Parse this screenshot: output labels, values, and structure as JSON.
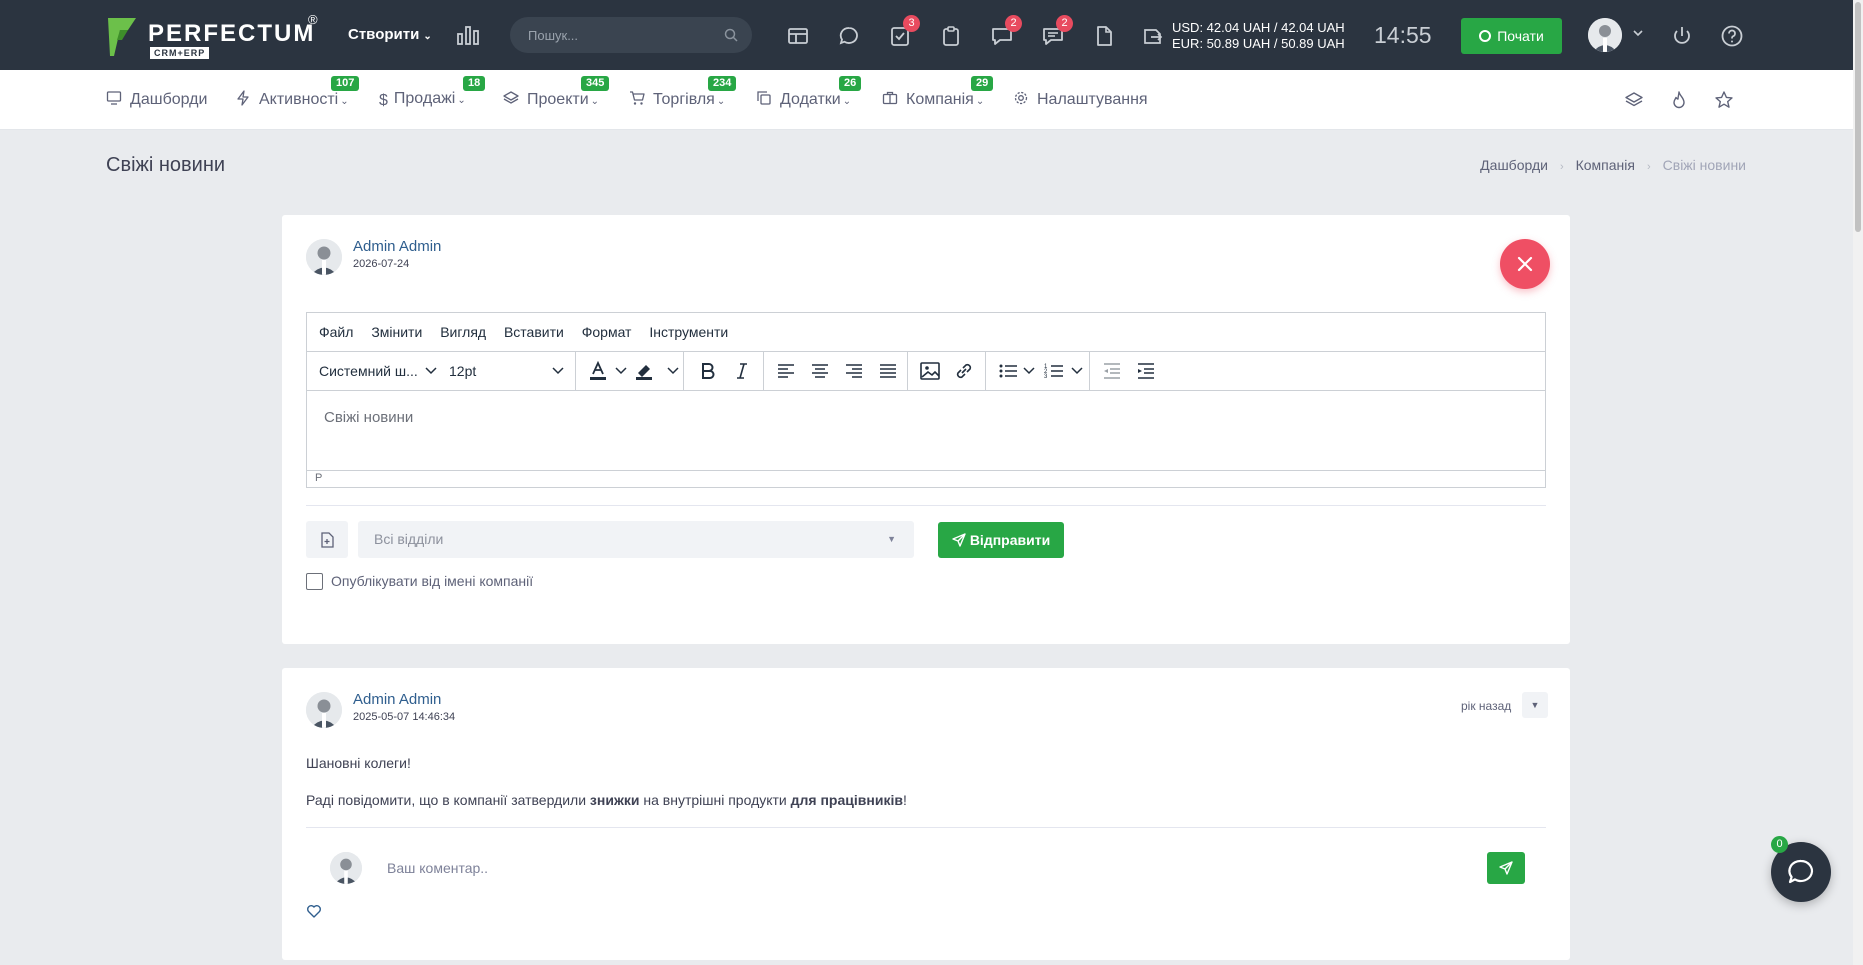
{
  "brand": {
    "name": "PERFECTUM",
    "sub": "CRM+ERP",
    "reg": "®"
  },
  "topbar": {
    "create_label": "Створити",
    "search_placeholder": "Пошук...",
    "badges": {
      "tasks": "3",
      "chat": "2",
      "messages": "2"
    },
    "currency_usd": "USD: 42.04 UAH / 42.04 UAH",
    "currency_eur": "EUR: 50.89 UAH / 50.89 UAH",
    "clock": "14:55",
    "start_label": "Почати"
  },
  "nav": {
    "items": [
      {
        "label": "Дашборди",
        "badge": ""
      },
      {
        "label": "Активності",
        "badge": "107"
      },
      {
        "label": "Продажі",
        "badge": "18"
      },
      {
        "label": "Проекти",
        "badge": "345"
      },
      {
        "label": "Торгівля",
        "badge": "234"
      },
      {
        "label": "Додатки",
        "badge": "26"
      },
      {
        "label": "Компанія",
        "badge": "29"
      },
      {
        "label": "Налаштування",
        "badge": ""
      }
    ]
  },
  "page": {
    "title": "Свіжі новини",
    "breadcrumb": [
      "Дашборди",
      "Компанія",
      "Свіжі новини"
    ]
  },
  "composer": {
    "author": "Admin Admin",
    "date": "2026-07-24",
    "menu": [
      "Файл",
      "Змінити",
      "Вигляд",
      "Вставити",
      "Формат",
      "Інструменти"
    ],
    "font_family": "Системний ш...",
    "font_size": "12pt",
    "content": "Свіжі новини",
    "status_path": "P",
    "department_placeholder": "Всі відділи",
    "send_label": "Відправити",
    "publish_as_company_label": "Опублікувати від імені компанії"
  },
  "post": {
    "author": "Admin Admin",
    "datetime": "2025-05-07 14:46:34",
    "time_ago": "рік назад",
    "greeting": "Шановні колеги!",
    "body_part1": "Раді повідомити, що в компанії затвердили ",
    "body_bold1": "знижки",
    "body_part2": " на внутрішні продукти ",
    "body_bold2": "для працівників",
    "body_part3": "!",
    "comment_placeholder": "Ваш коментар.."
  },
  "chat": {
    "badge": "0"
  },
  "colors": {
    "topbar": "#2b3440",
    "accent_green": "#28a745",
    "danger": "#ef4f64",
    "link": "#2f5e8e"
  }
}
